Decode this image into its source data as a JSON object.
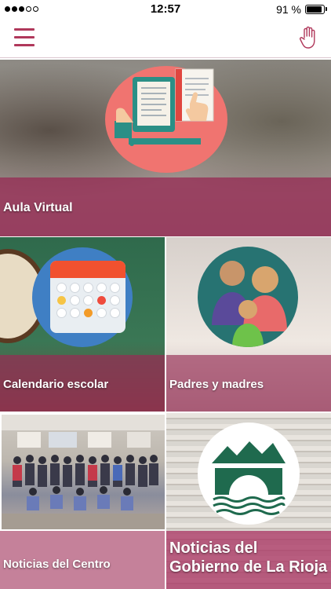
{
  "status_bar": {
    "time": "12:57",
    "battery_percent": "91 %",
    "battery_level": 0.91,
    "signal_dots_filled": 3,
    "signal_dots_total": 5
  },
  "header": {
    "menu_icon": "hamburger-menu-icon",
    "right_icon": "raised-hand-icon",
    "accent_color": "#b0385b"
  },
  "tiles": [
    {
      "label": "Aula Virtual",
      "icon": "tablet-document-icon"
    },
    {
      "label": "Calendario escolar",
      "icon": "calendar-icon"
    },
    {
      "label": "Padres y madres",
      "icon": "family-icon"
    },
    {
      "label": "Noticias del Centro",
      "icon": "group-photo"
    },
    {
      "label": "Noticias del Gobierno de La Rioja",
      "icon": "bridge-mountains-icon"
    }
  ]
}
